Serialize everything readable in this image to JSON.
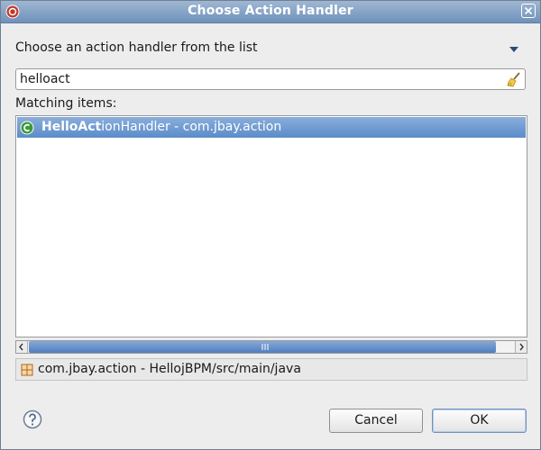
{
  "window": {
    "title": "Choose Action Handler"
  },
  "dialog": {
    "description": "Choose an action handler from the list",
    "filter_value": "helloact",
    "matching_label": "Matching items:",
    "items": [
      {
        "match": "HelloAct",
        "rest": "ionHandler - com.jbay.action",
        "icon": "java-class-icon",
        "selected": true
      }
    ],
    "status": {
      "text": "com.jbay.action - HellojBPM/src/main/java",
      "icon": "package-icon"
    }
  },
  "buttons": {
    "cancel": "Cancel",
    "ok": "OK"
  },
  "colors": {
    "titlebar": "#7f9fc6",
    "selection": "#5b8cc9",
    "dialog_bg": "#ededed"
  }
}
